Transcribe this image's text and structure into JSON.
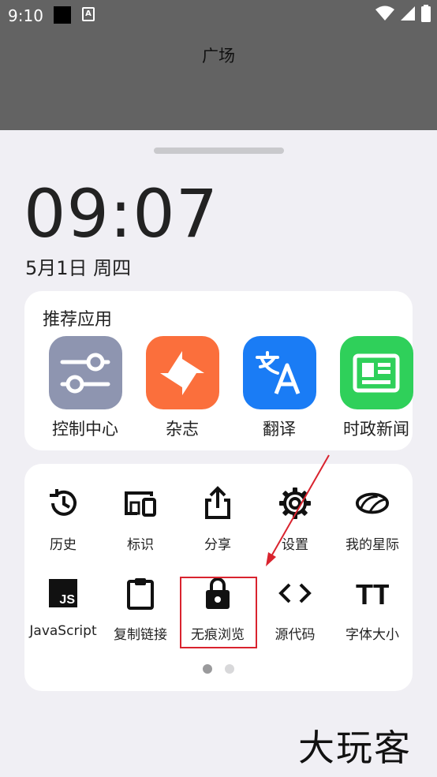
{
  "status_bar": {
    "time": "9:10",
    "icon_letter": "A"
  },
  "page": {
    "title": "广场"
  },
  "clock": {
    "time": "09:07",
    "date": "5月1日 周四"
  },
  "recommended": {
    "title": "推荐应用",
    "apps": [
      {
        "label": "控制中心",
        "icon": "sliders-icon",
        "color": "#8e95b0"
      },
      {
        "label": "杂志",
        "icon": "pinwheel-icon",
        "color": "#fb6f3c"
      },
      {
        "label": "翻译",
        "icon": "translate-icon",
        "color": "#1a7cf5"
      },
      {
        "label": "时政新闻",
        "icon": "news-icon",
        "color": "#2fd05a"
      }
    ]
  },
  "tools": {
    "items": [
      {
        "label": "历史",
        "icon": "history-icon"
      },
      {
        "label": "标识",
        "icon": "devices-icon"
      },
      {
        "label": "分享",
        "icon": "share-icon"
      },
      {
        "label": "设置",
        "icon": "gear-icon"
      },
      {
        "label": "我的星际",
        "icon": "planet-icon"
      },
      {
        "label": "JavaScript",
        "icon": "js-icon"
      },
      {
        "label": "复制链接",
        "icon": "clipboard-icon"
      },
      {
        "label": "无痕浏览",
        "icon": "lock-icon"
      },
      {
        "label": "源代码",
        "icon": "code-icon"
      },
      {
        "label": "字体大小",
        "icon": "font-size-icon"
      }
    ],
    "pages": 2,
    "current_page": 1,
    "js_badge": "JS",
    "font_badge": "TT"
  },
  "watermark": "大玩客",
  "highlight_color": "#d9232e"
}
